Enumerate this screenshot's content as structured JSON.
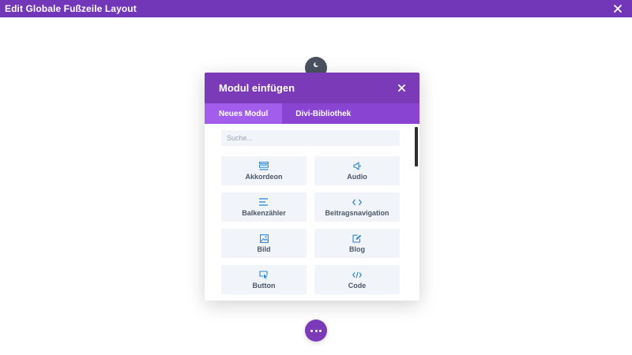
{
  "topbar": {
    "title": "Edit Globale Fußzeile Layout",
    "close_icon": "close-icon"
  },
  "modal": {
    "title": "Modul einfügen",
    "close_icon": "close-icon",
    "tabs": [
      {
        "label": "Neues Modul",
        "active": true
      },
      {
        "label": "Divi-Bibliothek",
        "active": false
      }
    ],
    "search": {
      "placeholder": "Suche...",
      "value": ""
    },
    "modules": [
      {
        "label": "Akkordeon",
        "icon": "accordion-icon"
      },
      {
        "label": "Audio",
        "icon": "speaker-icon"
      },
      {
        "label": "Balkenzähler",
        "icon": "bar-counter-icon"
      },
      {
        "label": "Beitragsnavigation",
        "icon": "code-arrows-icon"
      },
      {
        "label": "Bild",
        "icon": "image-icon"
      },
      {
        "label": "Blog",
        "icon": "blog-edit-icon"
      },
      {
        "label": "Button",
        "icon": "cursor-button-icon"
      },
      {
        "label": "Code",
        "icon": "code-slash-icon"
      }
    ]
  },
  "colors": {
    "topbar": "#7236b8",
    "modal_header": "#7b3ab7",
    "tabs_bar": "#8a44d2",
    "active_tab": "#a25ded",
    "icon_blue": "#2b87da",
    "tile_bg": "#f1f4f8"
  }
}
